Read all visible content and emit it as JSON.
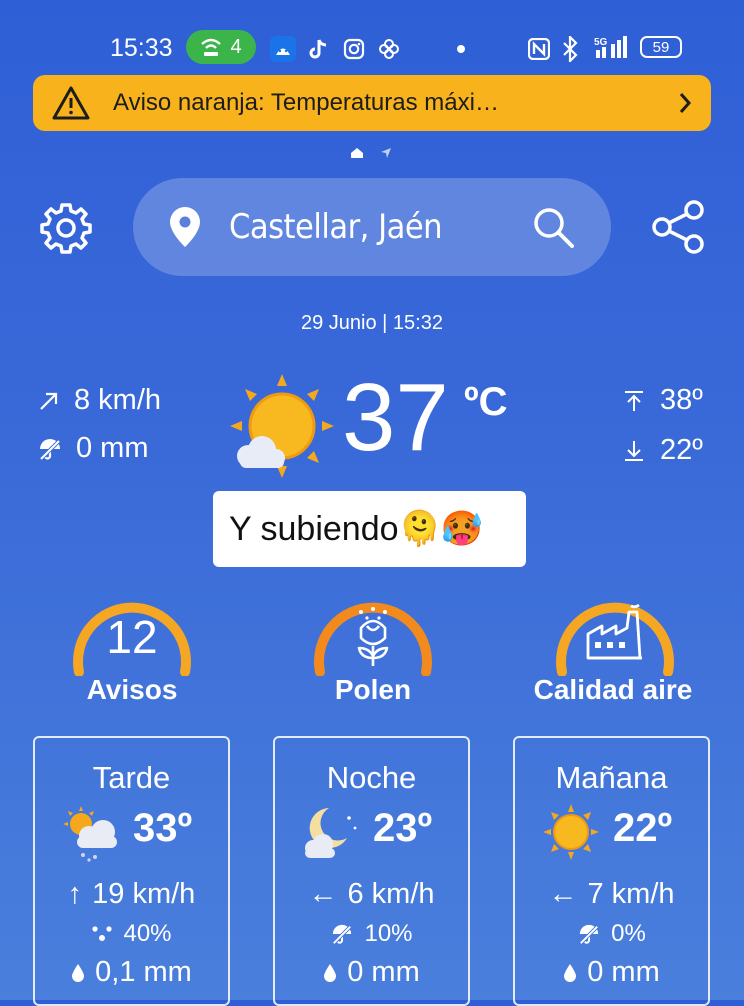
{
  "status_bar": {
    "time": "15:33",
    "hotspot_count": "4",
    "battery": "59"
  },
  "alert": {
    "text": "Aviso naranja: Temperaturas máxi…"
  },
  "search": {
    "location": "Castellar, Jaén"
  },
  "current": {
    "datetime": "29 Junio | 15:32",
    "wind": "8 km/h",
    "rain": "0 mm",
    "temperature": "37",
    "unit": "ºC",
    "max": "38º",
    "min": "22º",
    "note": "Y subiendo🫠🥵"
  },
  "gauges": [
    {
      "label": "Avisos",
      "value": "12"
    },
    {
      "label": "Polen"
    },
    {
      "label": "Calidad aire"
    }
  ],
  "forecast": [
    {
      "title": "Tarde",
      "temp": "33º",
      "wind": "19 km/h",
      "precip_prob": "40%",
      "rain": "0,1 mm",
      "wind_arrow": "↑"
    },
    {
      "title": "Noche",
      "temp": "23º",
      "wind": "6 km/h",
      "precip_prob": "10%",
      "rain": "0 mm",
      "wind_arrow": "←"
    },
    {
      "title": "Mañana",
      "temp": "22º",
      "wind": "7 km/h",
      "precip_prob": "0%",
      "rain": "0 mm",
      "wind_arrow": "←"
    }
  ],
  "colors": {
    "alert": "#f7b21c",
    "gauge_amber": "#f5a623",
    "gauge_orange": "#f28a1e"
  }
}
